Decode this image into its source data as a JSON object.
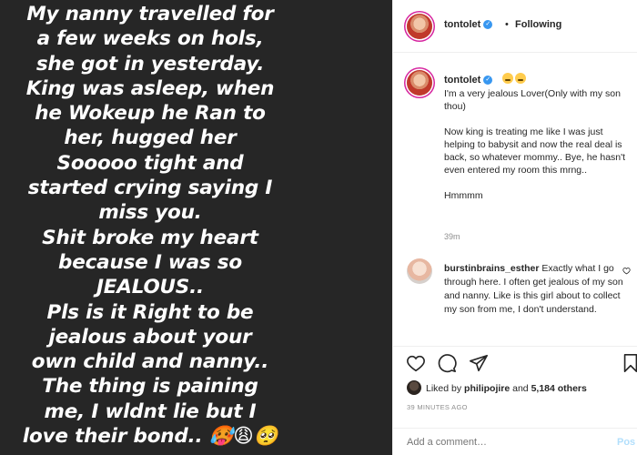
{
  "story": {
    "lines": [
      "My nanny travelled for",
      "a few weeks on hols,",
      "she got in yesterday.",
      "King was asleep, when",
      "he Wokeup he Ran to",
      "her, hugged her",
      "Sooooo tight and",
      "started crying saying I",
      "miss you.",
      "Shit broke my heart",
      "because I was so",
      "JEALOUS..",
      "Pls is it Right to be",
      "jealous about your",
      "own child and nanny..",
      "The thing is paining",
      "me, I wldnt lie but I",
      "love their bond.. 🥵😩🥺"
    ]
  },
  "header": {
    "username": "tontolet",
    "dot": "•",
    "follow_status": "Following"
  },
  "caption": {
    "username": "tontolet",
    "paragraphs": [
      "I'm a very jealous Lover(Only with my son thou)",
      "Now king is treating me like I was just helping to babysit and now the real deal is back, so whatever mommy.. Bye, he hasn't even entered my room this mrng..",
      "Hmmmm"
    ],
    "time": "39m"
  },
  "comment": {
    "username": "burstinbrains_esther",
    "text": "Exactly what I go through here. I often get jealous of my son and nanny. Like is this girl about to collect my son from me, I don't understand."
  },
  "likes": {
    "prefix": "Liked by",
    "user": "philipojire",
    "and": "and",
    "others": "5,184 others"
  },
  "post_time": "39 MINUTES AGO",
  "add_comment": {
    "placeholder": "Add a comment…",
    "post_label": "Pos"
  },
  "icons": {
    "like": "heart-icon",
    "comment": "comment-bubble-icon",
    "share": "paper-plane-icon",
    "save": "bookmark-icon"
  },
  "colors": {
    "story_bg": "#262626",
    "verified": "#3897f0",
    "muted": "#8e8e8e",
    "post_button": "#b2dffc"
  }
}
